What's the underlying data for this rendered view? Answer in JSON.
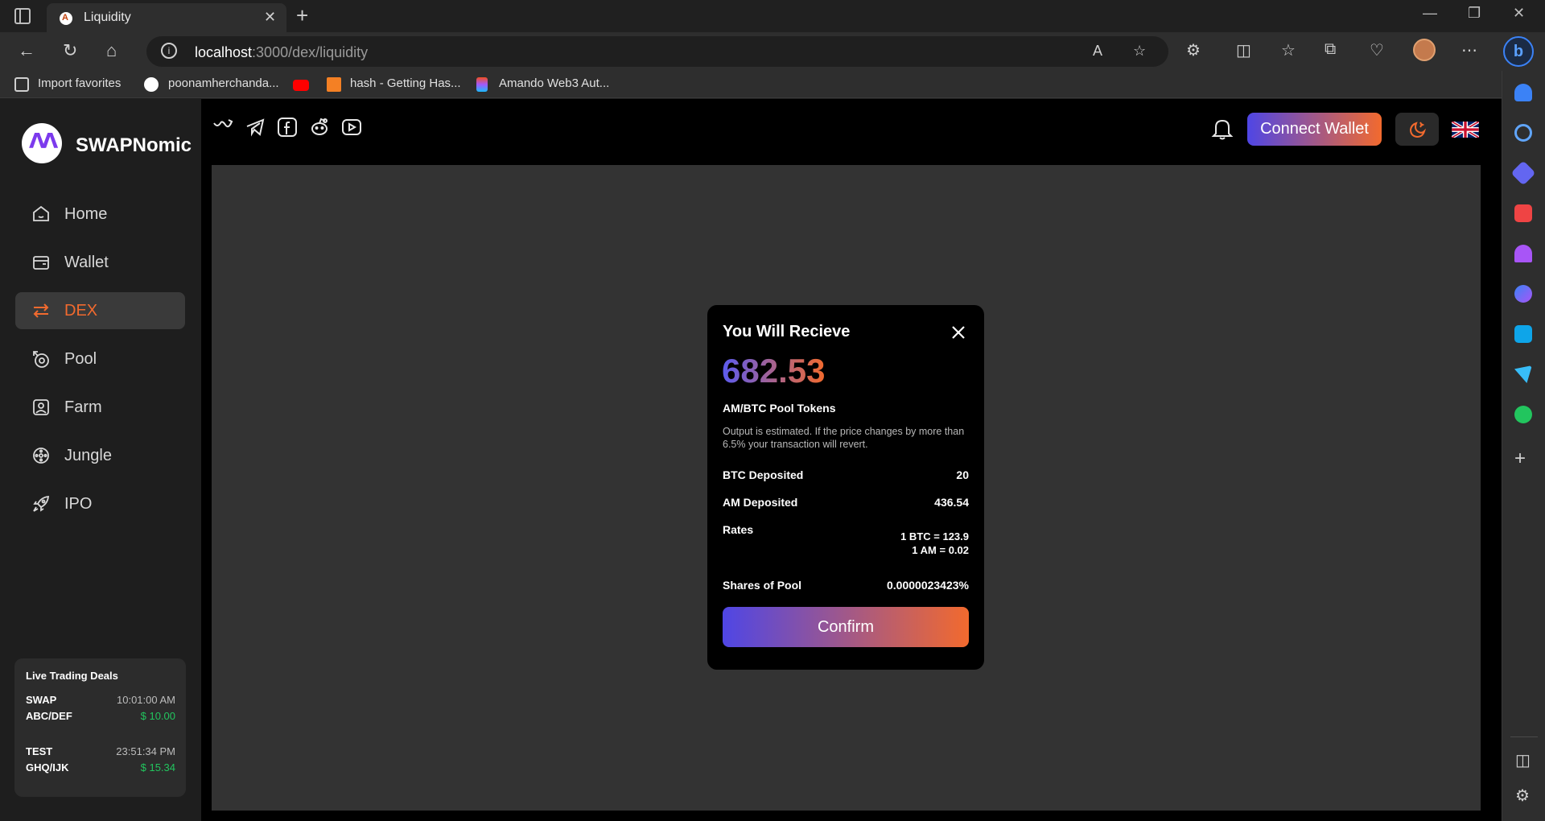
{
  "browser": {
    "tab_title": "Liquidity",
    "url_host": "localhost",
    "url_path": ":3000/dex/liquidity",
    "favorites": [
      {
        "label": "Import favorites"
      },
      {
        "label": "poonamherchanda..."
      },
      {
        "label": "hash - Getting Has..."
      },
      {
        "label": "Amando Web3 Aut..."
      }
    ]
  },
  "app": {
    "brand": "SWAPNomic",
    "menu": [
      {
        "label": "Home",
        "icon": "home-icon"
      },
      {
        "label": "Wallet",
        "icon": "wallet-icon"
      },
      {
        "label": "DEX",
        "icon": "swap-arrows-icon",
        "active": true
      },
      {
        "label": "Pool",
        "icon": "pool-icon"
      },
      {
        "label": "Farm",
        "icon": "farm-icon"
      },
      {
        "label": "Jungle",
        "icon": "jungle-icon"
      },
      {
        "label": "IPO",
        "icon": "rocket-icon"
      }
    ],
    "deals": {
      "title": "Live Trading Deals",
      "items": [
        {
          "name": "SWAP",
          "pair": "ABC/DEF",
          "time": "10:01:00 AM",
          "price": "$ 10.00"
        },
        {
          "name": "TEST",
          "pair": "GHQ/IJK",
          "time": "23:51:34 PM",
          "price": "$ 15.34"
        }
      ]
    },
    "topbar": {
      "connect_label": "Connect Wallet"
    }
  },
  "modal": {
    "title": "You Will Recieve",
    "amount": "682.53",
    "token": "AM/BTC Pool Tokens",
    "note": "Output is estimated. If the price changes by more than 6.5% your transaction will revert.",
    "rows": [
      {
        "label": "BTC Deposited",
        "value": "20"
      },
      {
        "label": "AM Deposited",
        "value": "436.54"
      },
      {
        "label": "Rates",
        "value1": "1 BTC = 123.9",
        "value2": "1 AM = 0.02"
      },
      {
        "label": "Shares of Pool",
        "value": "0.0000023423%"
      }
    ],
    "confirm_label": "Confirm"
  },
  "colors": {
    "accent_orange": "#f26a2e",
    "accent_indigo": "#4f46e5",
    "price_green": "#22c55e"
  }
}
